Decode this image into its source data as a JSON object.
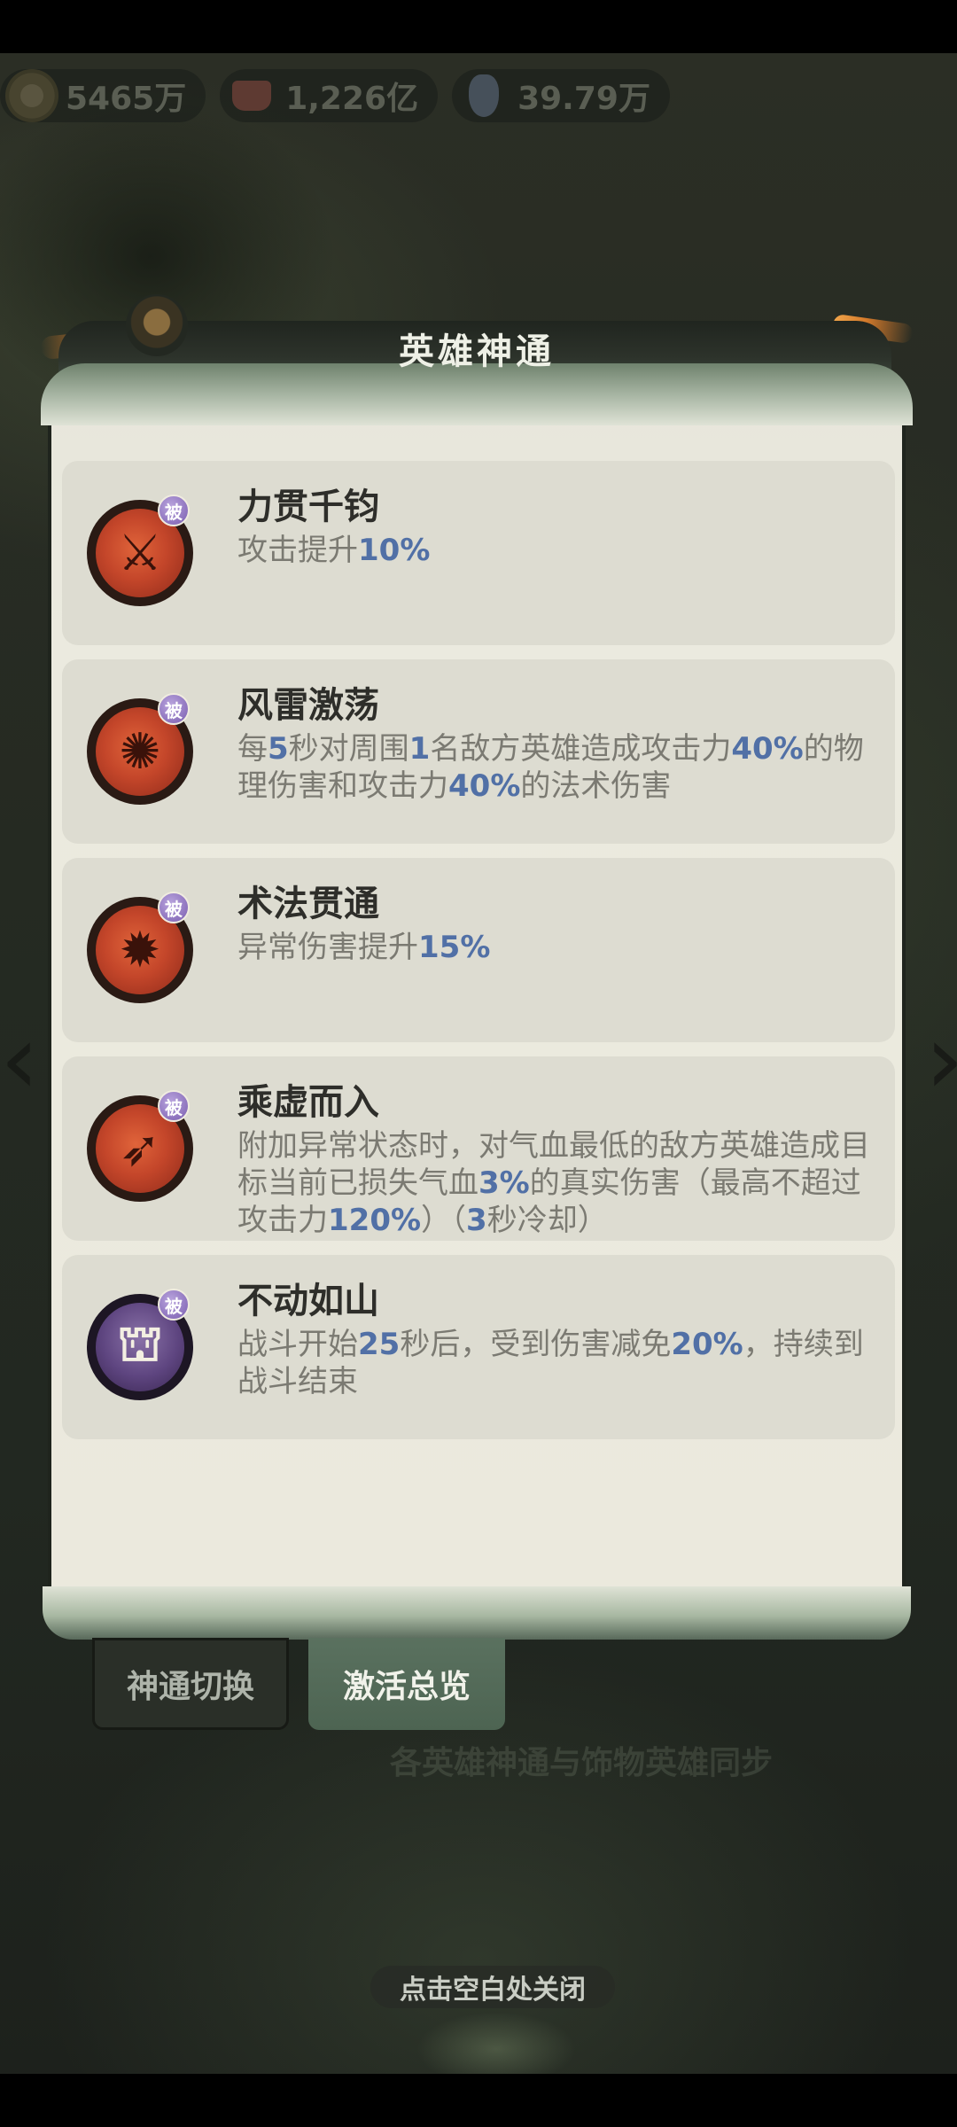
{
  "currencies": [
    {
      "icon": "copper-coin-icon",
      "value": "5465万"
    },
    {
      "icon": "red-gem-chest-icon",
      "value": "1,226亿"
    },
    {
      "icon": "potion-bottle-icon",
      "value": "39.79万"
    }
  ],
  "dialog": {
    "title": "英雄神通"
  },
  "skills": [
    {
      "name": "力贯千钧",
      "badge": "被",
      "icon": "crossed-swords-icon",
      "desc": [
        [
          "攻击提升",
          false
        ],
        [
          "10%",
          true
        ]
      ]
    },
    {
      "name": "风雷激荡",
      "badge": "被",
      "icon": "thunder-figure-icon",
      "desc": [
        [
          "每",
          false
        ],
        [
          "5",
          true
        ],
        [
          "秒对周围",
          false
        ],
        [
          "1",
          true
        ],
        [
          "名敌方英雄造成攻击力",
          false
        ],
        [
          "40%",
          true
        ],
        [
          "的物理伤害和攻击力",
          false
        ],
        [
          "40%",
          true
        ],
        [
          "的法术伤害",
          false
        ]
      ]
    },
    {
      "name": "术法贯通",
      "badge": "被",
      "icon": "claw-burst-icon",
      "desc": [
        [
          "异常伤害提升",
          false
        ],
        [
          "15%",
          true
        ]
      ]
    },
    {
      "name": "乘虚而入",
      "badge": "被",
      "icon": "arrow-burst-icon",
      "desc": [
        [
          "附加异常状态时，对气血最低的敌方英雄造成目标当前已损失气血",
          false
        ],
        [
          "3%",
          true
        ],
        [
          "的真实伤害（最高不超过攻击力",
          false
        ],
        [
          "120%",
          true
        ],
        [
          "）（",
          false
        ],
        [
          "3",
          true
        ],
        [
          "秒冷却）",
          false
        ]
      ]
    },
    {
      "name": "不动如山",
      "badge": "被",
      "icon": "bell-tower-icon",
      "desc": [
        [
          "战斗开始",
          false
        ],
        [
          "25",
          true
        ],
        [
          "秒后，受到伤害减免",
          false
        ],
        [
          "20%",
          true
        ],
        [
          "，持续到战斗结束",
          false
        ]
      ]
    }
  ],
  "tabs": {
    "switch_label": "神通切换",
    "overview_label": "激活总览"
  },
  "background_caption": "各英雄神通与饰物英雄同步",
  "close_hint": "点击空白处关闭",
  "colors": {
    "highlight": "#5170a6",
    "card": "#dddcd1",
    "panel": "#ebeadf",
    "active_tab": "#566d5b"
  }
}
